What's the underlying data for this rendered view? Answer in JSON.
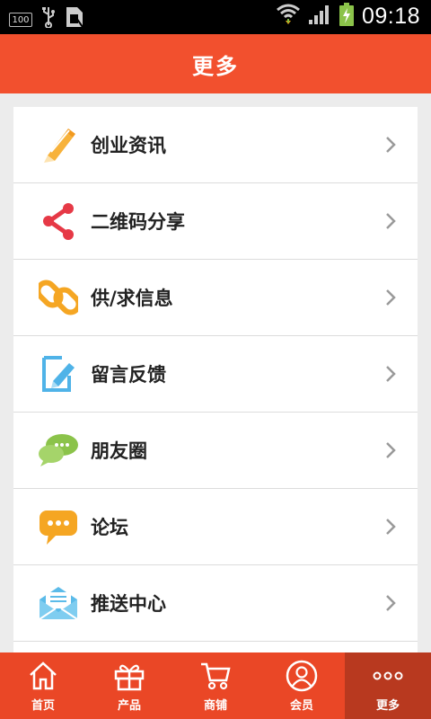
{
  "status_bar": {
    "battery_badge": "100",
    "time": "09:18"
  },
  "header": {
    "title": "更多"
  },
  "menu": {
    "items": [
      {
        "label": "创业资讯",
        "icon": "pencil-icon"
      },
      {
        "label": "二维码分享",
        "icon": "share-icon"
      },
      {
        "label": "供/求信息",
        "icon": "link-icon"
      },
      {
        "label": "留言反馈",
        "icon": "feedback-edit-icon"
      },
      {
        "label": "朋友圈",
        "icon": "chat-bubbles-icon"
      },
      {
        "label": "论坛",
        "icon": "forum-bubble-icon"
      },
      {
        "label": "推送中心",
        "icon": "envelope-icon"
      }
    ]
  },
  "bottom_nav": {
    "tabs": [
      {
        "label": "首页",
        "icon": "home-icon"
      },
      {
        "label": "产品",
        "icon": "gift-icon"
      },
      {
        "label": "商铺",
        "icon": "cart-icon"
      },
      {
        "label": "会员",
        "icon": "user-icon"
      },
      {
        "label": "更多",
        "icon": "more-dots-icon",
        "active": true
      }
    ]
  },
  "colors": {
    "header_bg": "#f2502e",
    "nav_bg": "#ea4726",
    "nav_active_bg": "#b8391f"
  }
}
